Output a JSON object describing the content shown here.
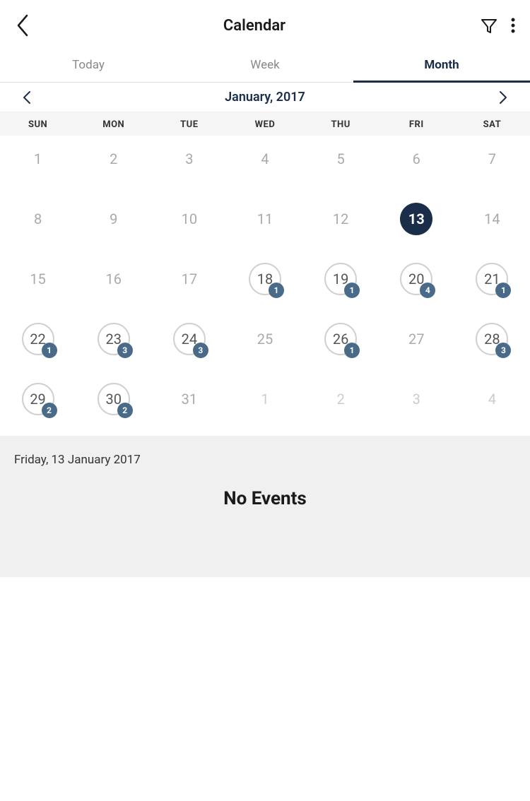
{
  "header": {
    "title": "Calendar",
    "back_label": "‹",
    "filter_icon": "filter",
    "more_icon": "more"
  },
  "tabs": [
    {
      "id": "today",
      "label": "Today",
      "active": false
    },
    {
      "id": "week",
      "label": "Week",
      "active": false
    },
    {
      "id": "month",
      "label": "Month",
      "active": true
    }
  ],
  "month_nav": {
    "title": "January, 2017",
    "prev_label": "‹",
    "next_label": "›"
  },
  "day_headers": [
    "SUN",
    "MON",
    "TUE",
    "WED",
    "THU",
    "FRI",
    "SAT"
  ],
  "weeks": [
    [
      {
        "day": 1,
        "state": "normal",
        "badge": 0
      },
      {
        "day": 2,
        "state": "normal",
        "badge": 0
      },
      {
        "day": 3,
        "state": "normal",
        "badge": 0
      },
      {
        "day": 4,
        "state": "normal",
        "badge": 0
      },
      {
        "day": 5,
        "state": "normal",
        "badge": 0
      },
      {
        "day": 6,
        "state": "normal",
        "badge": 0
      },
      {
        "day": 7,
        "state": "normal",
        "badge": 0
      }
    ],
    [
      {
        "day": 8,
        "state": "normal",
        "badge": 0
      },
      {
        "day": 9,
        "state": "normal",
        "badge": 0
      },
      {
        "day": 10,
        "state": "normal",
        "badge": 0
      },
      {
        "day": 11,
        "state": "normal",
        "badge": 0
      },
      {
        "day": 12,
        "state": "normal",
        "badge": 0
      },
      {
        "day": 13,
        "state": "today",
        "badge": 0
      },
      {
        "day": 14,
        "state": "normal",
        "badge": 0
      }
    ],
    [
      {
        "day": 15,
        "state": "normal",
        "badge": 0
      },
      {
        "day": 16,
        "state": "normal",
        "badge": 0
      },
      {
        "day": 17,
        "state": "normal",
        "badge": 0
      },
      {
        "day": 18,
        "state": "ring",
        "badge": 1
      },
      {
        "day": 19,
        "state": "ring",
        "badge": 1
      },
      {
        "day": 20,
        "state": "ring",
        "badge": 4
      },
      {
        "day": 21,
        "state": "ring",
        "badge": 1
      }
    ],
    [
      {
        "day": 22,
        "state": "ring",
        "badge": 1
      },
      {
        "day": 23,
        "state": "ring",
        "badge": 3
      },
      {
        "day": 24,
        "state": "ring",
        "badge": 3
      },
      {
        "day": 25,
        "state": "normal",
        "badge": 0
      },
      {
        "day": 26,
        "state": "ring",
        "badge": 1
      },
      {
        "day": 27,
        "state": "normal",
        "badge": 0
      },
      {
        "day": 28,
        "state": "ring",
        "badge": 3
      }
    ],
    [
      {
        "day": 29,
        "state": "ring",
        "badge": 2
      },
      {
        "day": 30,
        "state": "ring",
        "badge": 2
      },
      {
        "day": 31,
        "state": "normal",
        "badge": 0
      },
      {
        "day": 1,
        "state": "other",
        "badge": 0
      },
      {
        "day": 2,
        "state": "other",
        "badge": 0
      },
      {
        "day": 3,
        "state": "other",
        "badge": 0
      },
      {
        "day": 4,
        "state": "other",
        "badge": 0
      }
    ]
  ],
  "selected_date": "Friday, 13 January 2017",
  "no_events_label": "No Events",
  "colors": {
    "today_bg": "#1a2e4a",
    "ring_color": "#d0d0d0",
    "badge_bg": "#4a6a8a",
    "active_tab_color": "#1a2e4a"
  }
}
